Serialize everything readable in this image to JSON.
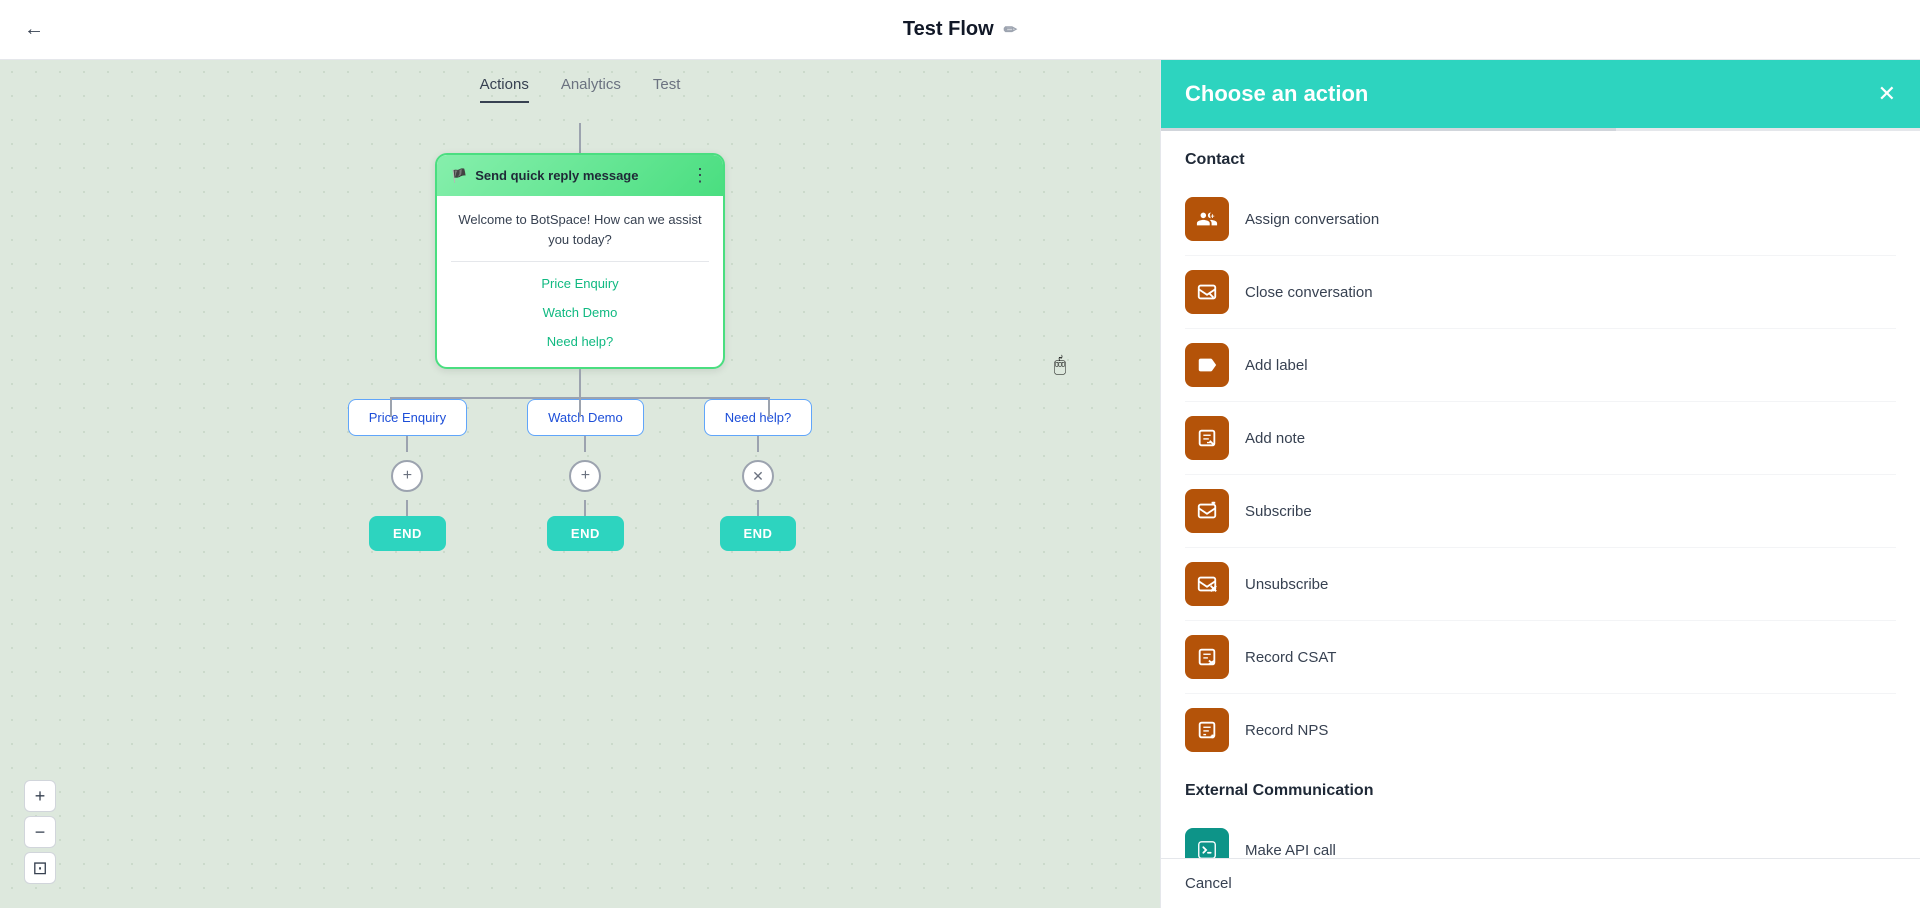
{
  "header": {
    "title": "Test Flow",
    "back_label": "←",
    "edit_icon": "✏"
  },
  "tabs": [
    {
      "label": "Actions",
      "active": true
    },
    {
      "label": "Analytics",
      "active": false
    },
    {
      "label": "Test",
      "active": false
    }
  ],
  "flow": {
    "message_card": {
      "title": "Send quick reply message",
      "body": "Welcome to BotSpace! How can we assist you today?",
      "quick_replies": [
        "Price Enquiry",
        "Watch Demo",
        "Need help?"
      ]
    },
    "branches": [
      {
        "label": "Price Enquiry",
        "has_add": true,
        "has_close": false,
        "end": "END"
      },
      {
        "label": "Watch Demo",
        "has_add": true,
        "has_close": false,
        "end": "END"
      },
      {
        "label": "Need help?",
        "has_add": false,
        "has_close": true,
        "end": "END"
      }
    ]
  },
  "zoom_controls": {
    "zoom_in": "+",
    "zoom_out": "−",
    "fit": "⊡"
  },
  "right_panel": {
    "title": "Choose an action",
    "close_icon": "✕",
    "sections": [
      {
        "title": "Contact",
        "items": [
          {
            "label": "Assign conversation",
            "icon": "person_add"
          },
          {
            "label": "Close conversation",
            "icon": "close_conv"
          },
          {
            "label": "Add label",
            "icon": "label"
          },
          {
            "label": "Add note",
            "icon": "note"
          },
          {
            "label": "Subscribe",
            "icon": "subscribe"
          },
          {
            "label": "Unsubscribe",
            "icon": "unsubscribe"
          },
          {
            "label": "Record CSAT",
            "icon": "csat"
          },
          {
            "label": "Record NPS",
            "icon": "nps"
          }
        ]
      },
      {
        "title": "External Communication",
        "items": [
          {
            "label": "Make API call",
            "icon": "api",
            "color": "teal"
          }
        ]
      }
    ],
    "cancel_label": "Cancel"
  }
}
